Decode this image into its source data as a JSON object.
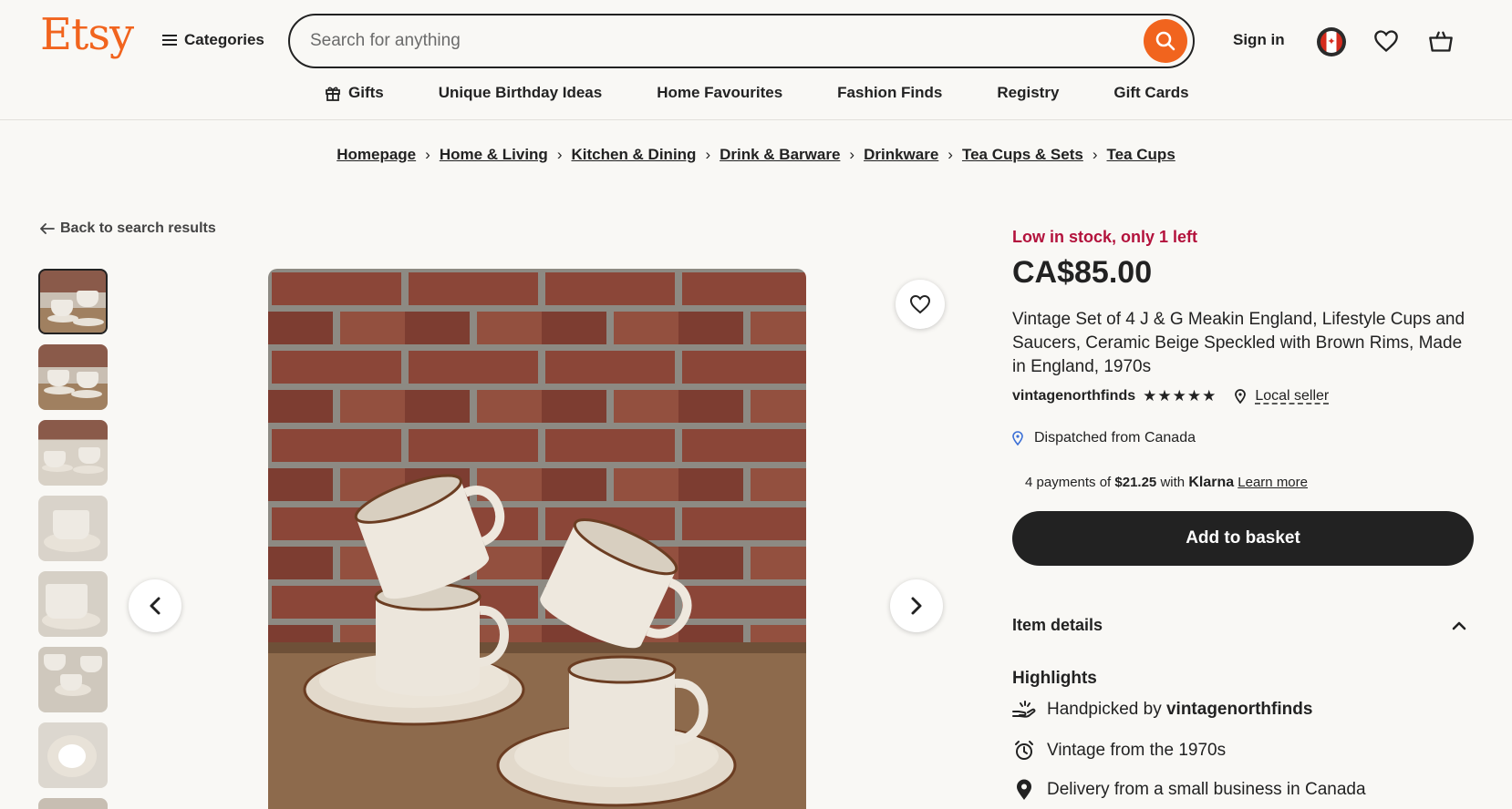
{
  "header": {
    "logo": "Etsy",
    "categories_label": "Categories",
    "search_placeholder": "Search for anything",
    "sign_in": "Sign in"
  },
  "subnav": [
    {
      "label": "Gifts",
      "icon": "gift-icon"
    },
    {
      "label": "Unique Birthday Ideas"
    },
    {
      "label": "Home Favourites"
    },
    {
      "label": "Fashion Finds"
    },
    {
      "label": "Registry"
    },
    {
      "label": "Gift Cards"
    }
  ],
  "breadcrumb": [
    "Homepage",
    "Home & Living",
    "Kitchen & Dining",
    "Drink & Barware",
    "Drinkware",
    "Tea Cups & Sets",
    "Tea Cups"
  ],
  "back_label": "Back to search results",
  "product": {
    "stock_notice": "Low in stock, only 1 left",
    "price": "CA$85.00",
    "title": "Vintage Set of 4 J & G Meakin England, Lifestyle Cups and Saucers, Ceramic Beige Speckled with Brown Rims, Made in England, 1970s",
    "shop_name": "vintagenorthfinds",
    "rating": 5,
    "local_seller_label": "Local seller",
    "dispatch": "Dispatched from Canada",
    "klarna": {
      "prefix": "4 payments of",
      "amount": "$21.25",
      "with": "with",
      "brand": "Klarna",
      "learn_more": "Learn more"
    },
    "add_to_basket": "Add to basket"
  },
  "details": {
    "section_label": "Item details",
    "highlights_label": "Highlights",
    "handpicked_prefix": "Handpicked by",
    "handpicked_shop": "vintagenorthfinds",
    "vintage": "Vintage from the 1970s",
    "delivery": "Delivery from a small business in Canada"
  },
  "colors": {
    "brand": "#f1641e",
    "alert": "#b3123c",
    "button_dark": "#222222"
  }
}
